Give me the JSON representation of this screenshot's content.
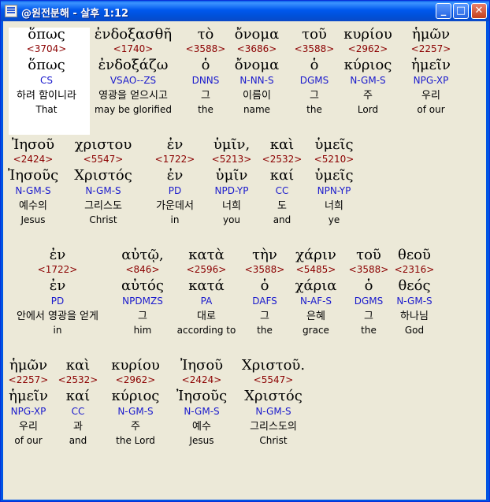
{
  "window": {
    "title": "@원전분해 - 살후 1:12",
    "buttons": {
      "minimize": "_",
      "maximize": "□",
      "close": "✕"
    }
  },
  "rows": [
    {
      "words": [
        {
          "greek": "ὅπως",
          "strong": "<3704>",
          "lemma": "ὅπως",
          "morph": "CS",
          "korean": "하려 함이니라",
          "english": "That"
        },
        {
          "greek": "ἐνδοξασθῆ",
          "strong": "<1740>",
          "lemma": "ἐνδοξάζω",
          "morph": "VSAO--ZS",
          "korean": "영광을 얻으시고",
          "english": "may be glorified"
        },
        {
          "greek": "τὸ",
          "strong": "<3588>",
          "lemma": "ὁ",
          "morph": "DNNS",
          "korean": "그",
          "english": "the"
        },
        {
          "greek": "ὄνομα",
          "strong": "<3686>",
          "lemma": "ὄνομα",
          "morph": "N-NN-S",
          "korean": "이름이",
          "english": "name"
        },
        {
          "greek": "τοῦ",
          "strong": "<3588>",
          "lemma": "ὁ",
          "morph": "DGMS",
          "korean": "그",
          "english": "the"
        },
        {
          "greek": "κυρίου",
          "strong": "<2962>",
          "lemma": "κύριος",
          "morph": "N-GM-S",
          "korean": "주",
          "english": "Lord"
        },
        {
          "greek": "ἡμῶν",
          "strong": "<2257>",
          "lemma": "ἡμεῖν",
          "morph": "NPG-XP",
          "korean": "우리",
          "english": "of our"
        }
      ]
    },
    {
      "words": [
        {
          "greek": "Ἰησοῦ",
          "strong": "<2424>",
          "lemma": "Ἰησοῦς",
          "morph": "N-GM-S",
          "korean": "예수의",
          "english": "Jesus"
        },
        {
          "greek": "χριστου",
          "strong": "<5547>",
          "lemma": "Χριστός",
          "morph": "N-GM-S",
          "korean": "그리스도",
          "english": "Christ"
        },
        {
          "greek": "ἐν",
          "strong": "<1722>",
          "lemma": "ἐν",
          "morph": "PD",
          "korean": "가운데서",
          "english": "in"
        },
        {
          "greek": "ὑμῖν,",
          "strong": "<5213>",
          "lemma": "ὑμῖν",
          "morph": "NPD-YP",
          "korean": "너희",
          "english": "you"
        },
        {
          "greek": "καὶ",
          "strong": "<2532>",
          "lemma": "καί",
          "morph": "CC",
          "korean": "도",
          "english": "and"
        },
        {
          "greek": "ὑμεῖς",
          "strong": "<5210>",
          "lemma": "ὑμεῖς",
          "morph": "NPN-YP",
          "korean": "너희",
          "english": "ye"
        }
      ]
    },
    {
      "words": [
        {
          "greek": "ἐν",
          "strong": "<1722>",
          "lemma": "ἐν",
          "morph": "PD",
          "korean": "안에서 영광을 얻게",
          "english": "in"
        },
        {
          "greek": "αὐτῷ,",
          "strong": "<846>",
          "lemma": "αὐτός",
          "morph": "NPDMZS",
          "korean": "그",
          "english": "him"
        },
        {
          "greek": "κατὰ",
          "strong": "<2596>",
          "lemma": "κατά",
          "morph": "PA",
          "korean": "대로",
          "english": "according to"
        },
        {
          "greek": "τὴν",
          "strong": "<3588>",
          "lemma": "ὁ",
          "morph": "DAFS",
          "korean": "그",
          "english": "the"
        },
        {
          "greek": "χάριν",
          "strong": "<5485>",
          "lemma": "χάρια",
          "morph": "N-AF-S",
          "korean": "은혜",
          "english": "grace"
        },
        {
          "greek": "τοῦ",
          "strong": "<3588>",
          "lemma": "ὁ",
          "morph": "DGMS",
          "korean": "그",
          "english": "the"
        },
        {
          "greek": "θεοῦ",
          "strong": "<2316>",
          "lemma": "θεός",
          "morph": "N-GM-S",
          "korean": "하나님",
          "english": "God"
        }
      ]
    },
    {
      "words": [
        {
          "greek": "ἡμῶν",
          "strong": "<2257>",
          "lemma": "ἡμεῖν",
          "morph": "NPG-XP",
          "korean": "우리",
          "english": "of our"
        },
        {
          "greek": "καὶ",
          "strong": "<2532>",
          "lemma": "καί",
          "morph": "CC",
          "korean": "과",
          "english": "and"
        },
        {
          "greek": "κυρίου",
          "strong": "<2962>",
          "lemma": "κύριος",
          "morph": "N-GM-S",
          "korean": "주",
          "english": "the Lord"
        },
        {
          "greek": "Ἰησοῦ",
          "strong": "<2424>",
          "lemma": "Ἰησοῦς",
          "morph": "N-GM-S",
          "korean": "예수",
          "english": "Jesus"
        },
        {
          "greek": "Χριστοῦ.",
          "strong": "<5547>",
          "lemma": "Χριστός",
          "morph": "N-GM-S",
          "korean": "그리스도의",
          "english": "Christ"
        }
      ]
    }
  ]
}
